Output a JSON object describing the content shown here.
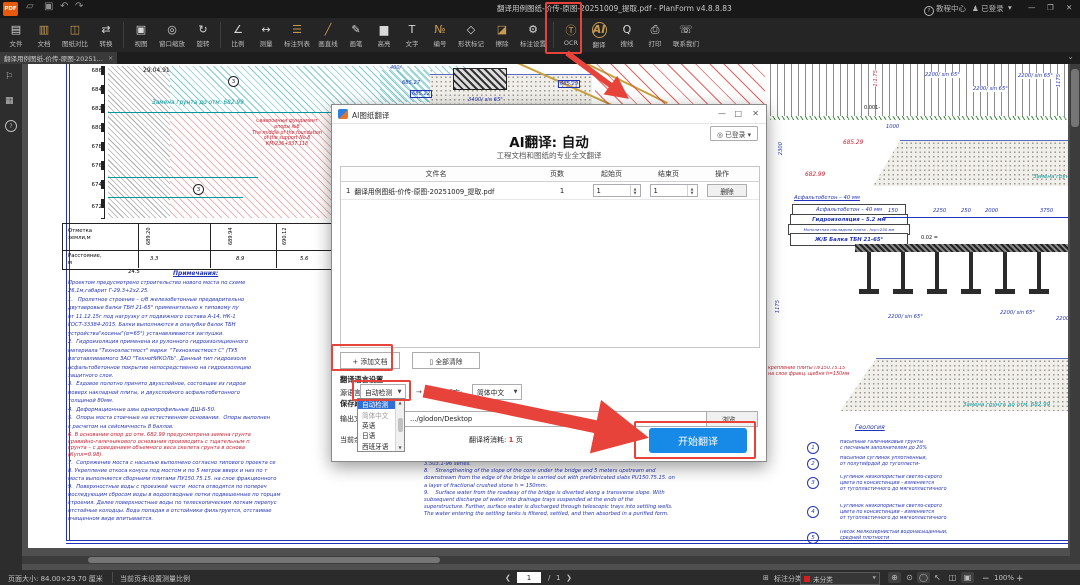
{
  "titlebar": {
    "logo": "PDF",
    "title": "翻译用例图纸-价传-原图-20251009_提取.pdf - PlanForm v4.8.8.83",
    "help": "教程中心",
    "login": "已登录",
    "theme_icon": "▾",
    "min_icon": "—",
    "max_icon": "❐",
    "close_icon": "✕",
    "open_icon": "▱",
    "save_icon": "▣",
    "undo_icon": "↶",
    "redo_icon": "↷"
  },
  "toolbar": {
    "items": [
      {
        "label": "文件",
        "glyph": "▤"
      },
      {
        "label": "文档",
        "glyph": "▥"
      },
      {
        "label": "图纸对比",
        "glyph": "◫"
      },
      {
        "label": "转换",
        "glyph": "⇄"
      },
      {
        "label": "视图",
        "glyph": "▣"
      },
      {
        "label": "窗口缩放",
        "glyph": "◎"
      },
      {
        "label": "旋转",
        "glyph": "↻"
      },
      {
        "label": "比例",
        "glyph": "∠"
      },
      {
        "label": "测量",
        "glyph": "↔"
      },
      {
        "label": "标注列表",
        "glyph": "☰"
      },
      {
        "label": "画直线",
        "glyph": "╱"
      },
      {
        "label": "画笔",
        "glyph": "✎"
      },
      {
        "label": "高亮",
        "glyph": "▆"
      },
      {
        "label": "文字",
        "glyph": "T"
      },
      {
        "label": "编号",
        "glyph": "№"
      },
      {
        "label": "形状标记",
        "glyph": "◇"
      },
      {
        "label": "擦除",
        "glyph": "◪"
      },
      {
        "label": "标注设置",
        "glyph": "⚙"
      },
      {
        "label": "OCR",
        "glyph": "Ⓣ"
      },
      {
        "label": "翻译",
        "glyph": "AI"
      },
      {
        "label": "搜线",
        "glyph": "Q"
      },
      {
        "label": "打印",
        "glyph": "⎙"
      },
      {
        "label": "联系我们",
        "glyph": "☏"
      }
    ]
  },
  "tabbar": {
    "active_tab": "翻译用例图纸-价传-原图-20251...",
    "close": "×",
    "collapse": "⌄"
  },
  "sidebar": {
    "bookmark": "⚐",
    "grid": "▦",
    "help": "?"
  },
  "dialog": {
    "title": "AI图纸翻译",
    "min": "—",
    "max": "□",
    "close": "✕",
    "login": "◎ 已登录 ▾",
    "heading": "AI翻译: 自动",
    "subheading": "工程文档和图纸的专业全文翻译",
    "col_filename": "文件名",
    "col_pages": "页数",
    "col_start": "起始页",
    "col_end": "结束页",
    "col_action": "操作",
    "row": {
      "index": "1",
      "filename": "翻译用例图纸-价传-原图-20251009_提取.pdf",
      "pages": "1",
      "start": "1",
      "end": "1",
      "action": "删除"
    },
    "spin_up": "▲",
    "spin_down": "▼",
    "add": "+ 添加文档",
    "clear": "▯ 全部清除",
    "lang_section": "翻译语言设置",
    "source_label": "源语言:",
    "source_value": "自动检测",
    "map_arrow": "→",
    "target_label": "目标语言:",
    "target_value": "简体中文",
    "combo_arrow": "▼",
    "dropdown": [
      "自动检测",
      "简体中文",
      "英语",
      "日语",
      "西班牙语"
    ],
    "dd_up": "▲",
    "dd_down": "▼",
    "path_section": "保存路径设置",
    "output_label": "输出文件夹:",
    "output_value": ".../glodon/Desktop",
    "browse": "浏览...",
    "balance_label": "当前余额:",
    "consume_label": "翻译将消耗:",
    "consume_value": "1",
    "consume_unit": "页",
    "start": "开始翻译"
  },
  "statusbar": {
    "page_size": "页面大小: 84.00×29.70 厘米",
    "scale_hint": "当前页未设置测量比例",
    "prev": "❮",
    "next": "❯",
    "page_current": "1",
    "page_sep": "/",
    "page_total": "1",
    "annot_label": "标注分类",
    "annot_value": "未分类",
    "icons": {
      "classify": "⊞",
      "zoom_area": "⊕",
      "eye": "⊙",
      "hand": "◯",
      "cursor": "↖",
      "split": "◫",
      "fit": "▣"
    },
    "zoom_out": "−",
    "zoom_value": "100%",
    "zoom_in": "+"
  },
  "drawing": {
    "elev": [
      "686",
      "684",
      "682",
      "680",
      "678",
      "676",
      "674",
      "672"
    ],
    "date": "29.04.91",
    "marker": "3",
    "replace_soil": "Замена грунта до отм. 682.99",
    "pile_note": "Сваебойный фундамент\nопоры №8\nThe middle of the foundation\nof the support No.8\nКМ/236+337.118",
    "table": {
      "row1_label": "Отметка\nземли,м",
      "row1_values": [
        "689.20",
        "689.94",
        "690.12"
      ],
      "row2_label": "Расстояние,\nм",
      "row2_values": [
        "3.3",
        "8.9",
        "5.6"
      ],
      "extra": "24.5"
    },
    "notes_title": "Примечания:",
    "notes_part1": "Проектом предусмотрено строительство нового моста по схеме\n26,1м,габарит Г-29.3+2х2.25.\n1.   Пролетное строение – с/б железобетонные предварительно\nдвутавровые балки ТБН 21-65° применительно к типовому пу\nот 11.12.15г под нагрузку от подвижного состава А-14, НК-1\nГОСТ-33384-2015. Балки выполняются в опалубке балок ТБН\nустройства\"косины\"(α=65°) устанавливаются заглушки.\n2.  Гидроизоляция применена из рулонного гидроизоляционного\nматериала \"Техноэластмост\" марки  \"Техноэластмост С\" (ТУ5\nизготавливаемого ЗАО \"ТехноНИКОЛЬ\". Данный тип гидроизоля\nасфальтобетонное покрытие непосредственно на гидроизоляцию\nзащитного слоя.\n3.  Ездовое полотно принято двухслойное, состоящее из гидрои\nповерх накладной плиты, и двухслойного асфальтобетонного\nтолщиной 80мм.\n4.  Деформационные швы однопрофильные ДШ-Б-50.\n5.  Опоры моста стоечные на естественном основании.  Опоры выполнен\nс расчетом на сейсмичность 8 баллов.",
    "notes_item6": "6. В основании опор до отм. 682.99 предусмотрена замена грунта\nгравийно-галечникового основания производить с тщательным п\nгрунта – с доведением объемного веса скелета грунта в основа\n(Купл=0.98).",
    "notes_part2": "7.  Сопряжение моста с насыпью выполнено согласно типового проекта се\n8. Укрепление откоса конуса под мостом и по 5 метров вверх и низ по т\nмоста выполняется сборными плитами ПУ150.75.15. на слое фракционного\n9.  Поверхностные воды с проезжей части  моста отводятся по попереч\nпоследующим сбросом воды в водоотводные лотки подвешенные по торцам\nстроения. Далее поверхностные воды по телескопическим лоткам перепус\nотстойные колодцы. Вода попадая в отстойники фильтруется, отстаивае\nочищенном виде впитывается.",
    "notes_en": "3.503.1-96 series.\n8.    Strengthening of the slope of the cone under the bridge and 5 meters upstream and\ndownstream from the edge of the bridge is carried out with prefabricated slabs PU150.75.15. on\na layer of fractional crushed stone h = 150mm.\n9.    Surface water from the roadway of the bridge is diverted along a transverse slope. With\nsubsequent discharge of water into drainage trays suspended at the ends of the\nsuperstructure. Further, surface water is discharged through telescopic trays into settling wells.\nThe water entering the settling tanks is filtered, settled, and then absorbed in a purified form.",
    "dim_2200": "2200/ sin 65°",
    "dim_3400": "3400/ sin 65°",
    "dim_400": "400/",
    "slope_11_75": "1:1.75",
    "dim_1175": "1175",
    "dim_0001": "0.001-",
    "dim_1000": "1000",
    "dim_2300": "2300",
    "dim_002": "0.02 =",
    "elev_68529": "685.29",
    "elev_68299": "682.99",
    "elev_68527": "685.27",
    "elev_68522": "685.22",
    "materials": [
      "Асфальтобетон  – 40 мм",
      "Асфальтобетон  – 40 мм",
      "Гидроизоляция  – 5.2 мм",
      "Монолитная накладная плита - hср=250 мм",
      "Ж/Б Балка ТБН 21-65°"
    ],
    "dims_row": [
      "150",
      "2250",
      "250",
      "2000",
      "3750"
    ],
    "plate_note": "крепление плиты ПУ150.75.15\nна слое фракц. щебня h=150мм",
    "geology_title": "Геология",
    "geology": [
      {
        "n": "1",
        "text": "Насыпные галечниковые грунты\nс песчаным заполнителем до 20%"
      },
      {
        "n": "2",
        "text": "Насыпной суглинок уплотненный,\nот полутвёрдой до тугопласти-"
      },
      {
        "n": "3",
        "text": "Суглинок низкопористый светло-серого\nцвета по консистенции - изменяется\nот тугопластичного до мягкопластичного"
      },
      {
        "n": "4",
        "text": "Суглинок низкопористый светло-серого\nцвета по консистенции - изменяется\nот тугопластичного до мягкопластичного"
      },
      {
        "n": "5",
        "text": "Песок мелкозернистый водонасыщенный,\nсредней плотности"
      }
    ],
    "colors": {
      "accent_red": "#e8433a",
      "blue_ink": "#2233bb",
      "teal_ink": "#00989d",
      "red_ink": "#cc2030"
    }
  }
}
